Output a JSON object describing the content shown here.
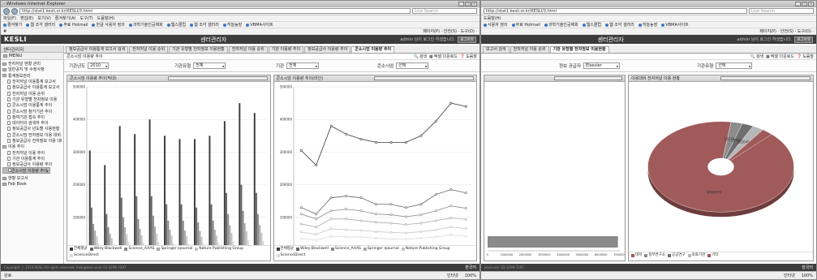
{
  "w1": {
    "title": "- Windows Internet Explorer",
    "url": "http://stat1.kesli.or.kr/KESLI/3.html",
    "search_placeholder": "Live Search",
    "menu": [
      "파일(F)",
      "편집(E)",
      "보기(V)",
      "즐겨찾기(A)",
      "도구(T)",
      "도움말(H)"
    ],
    "favorites_label": "즐겨찾기",
    "favorites": [
      "웹 조각 갤러리",
      "무료 Hotmail",
      "한글 사용자 정의",
      "과학기술인공제회",
      "웹스클럽",
      "웹 조각 갤러리",
      "히늘농장",
      "VBMA사이트"
    ],
    "tab_title": "#",
    "tab_tools": "페이지(P) · 안전(S) · 도구(O) ·",
    "app": {
      "logo": "KESLI",
      "title": "센터관리자",
      "user": "admin 님이 로그인 하셨습니다.",
      "logout": "로그아웃"
    },
    "sidebar": {
      "header": "센터관리자",
      "menu": "MENU",
      "items": [
        {
          "label": "전자저널 현황 관리",
          "level": 1
        },
        {
          "label": "일반공지 및 수정사항",
          "level": 1
        },
        {
          "label": "통계정보관리",
          "level": 1
        },
        {
          "label": "전자저널 이용통계 보고서",
          "level": 2
        },
        {
          "label": "정보공급사 이용통계 보고서",
          "level": 2
        },
        {
          "label": "전자저널 이용 순위",
          "level": 2
        },
        {
          "label": "기관 유형별 전자정보 이용",
          "level": 2
        },
        {
          "label": "콘소시엄 이용통계 추이",
          "level": 2
        },
        {
          "label": "콘소시엄 참가기관 추이",
          "level": 2
        },
        {
          "label": "참여기관 접속 추이",
          "level": 2
        },
        {
          "label": "데이터의 검색자 추이",
          "level": 2
        },
        {
          "label": "정보공급사 년도별 사용현황",
          "level": 2
        },
        {
          "label": "콘소시엄 전자정보 이용 대비",
          "level": 2
        },
        {
          "label": "정보공급사 전자정보 이용 대비",
          "level": 2
        },
        {
          "label": "이용 추이",
          "level": 1
        },
        {
          "label": "전자저널 이용 추이",
          "level": 2
        },
        {
          "label": "기관 이용통계 추이",
          "level": 2
        },
        {
          "label": "정보공급사 이용량 추이",
          "level": 2
        },
        {
          "label": "콘소시엄 이용량 추이",
          "level": 2
        },
        {
          "label": "현황 보고서",
          "level": 1
        },
        {
          "label": "Feb Book",
          "level": 1
        }
      ],
      "selected": 18
    },
    "tabs": [
      "정보공급사 이용통계 보고서 검색",
      "전자저널 이용 순위",
      "기관 유형별 전자정보 이용현황",
      "전자저널 이용 순위",
      "기관 이용량 추이",
      "정보공급사 이용량 추이",
      "콘소시엄 이용량 추이"
    ],
    "active_tab": 6,
    "sub": {
      "title": "콘소시엄 이용량 추이",
      "actions": [
        "검색",
        "엑셀 다운로드",
        "도움말"
      ]
    },
    "filters": [
      {
        "label": "기관년도",
        "value": "2010"
      },
      {
        "label": "기관유형",
        "value": "전체"
      },
      {
        "label": "기관",
        "value": "전체"
      },
      {
        "label": "콘소시엄",
        "value": "선택"
      }
    ],
    "chart1": {
      "title": "콘소시엄 이용량 추이(막대)"
    },
    "chart2": {
      "title": "콘소시엄 이용량 추이(라인)"
    },
    "footer": "Copyright ⓒ 2010 KESLI All rights reserved.  help@kesli.or.kr  02-3299-7297",
    "lang": "한국어",
    "status_left": "완료",
    "status_right": "인터넷",
    "zoom": "100%"
  },
  "w2": {
    "url": "http://stat1.kesli.or.kr/KESLI/3.html",
    "search_placeholder": "Live Search",
    "menu": [
      "도움말(H)"
    ],
    "favorites": [
      "사용자 정의",
      "무료 Hotmail",
      "과학기술인공제회",
      "웹스클럽",
      "웹 조각 갤러리",
      "히늘농장",
      "VBMA사이트"
    ],
    "tab_tools": "페이지(P) · 안전(S) · 도구(O) ·",
    "app": {
      "title": "센터관리자",
      "user": "admin 님이 로그인 하셨습니다.",
      "logout": "로그아웃"
    },
    "tabs": [
      "보고서 검색",
      "전자저널 이용 순위",
      "기관 유형별 전자정보 이용현황"
    ],
    "active_tab": 2,
    "sub": {
      "title": "정보공급사",
      "actions": [
        "검색",
        "엑셀 다운로드",
        "도움말"
      ]
    },
    "filters": [
      {
        "label": "정보 공급자",
        "value": "Elsevier"
      },
      {
        "label": "기관유형",
        "value": "선택"
      }
    ],
    "chart3": {
      "title": ""
    },
    "chart4": {
      "title": "이용대비 전자저널 이용 현황"
    },
    "footer": "kesli.or.kr  02-3299-7297",
    "lang": "한국어",
    "status_right": "인터넷",
    "zoom": "100%"
  },
  "colors": {
    "bar_series": [
      "#3a3a3a",
      "#666666",
      "#8a8a8a",
      "#a8a8a8",
      "#c4c4c4",
      "#dadada"
    ],
    "pie": [
      "#a05a5a",
      "#8c8c8c",
      "#6e6e6e",
      "#b7b7b7"
    ],
    "header_bg": "#3c3c3c"
  },
  "chart_data": [
    {
      "type": "bar",
      "title": "콘소시엄 이용량 추이(막대)",
      "categories": [
        "1월",
        "2월",
        "3월",
        "4월",
        "5월",
        "6월",
        "7월",
        "8월",
        "9월",
        "10월",
        "11월",
        "12월"
      ],
      "ylim": [
        0,
        500000
      ],
      "yticks": [
        "0",
        "100000",
        "200000",
        "300000",
        "400000",
        "500000"
      ],
      "series": [
        {
          "name": "전체평균",
          "values": [
            305000,
            260000,
            380000,
            355000,
            400000,
            350000,
            340000,
            340000,
            350000,
            395000,
            450000,
            420000
          ]
        },
        {
          "name": "Wiley-Blackwell",
          "values": [
            130000,
            110000,
            160000,
            165000,
            165000,
            140000,
            140000,
            130000,
            140000,
            175000,
            200000,
            175000
          ]
        },
        {
          "name": "Science_AAAS",
          "values": [
            80000,
            70000,
            100000,
            95000,
            105000,
            90000,
            90000,
            85000,
            90000,
            110000,
            120000,
            110000
          ]
        },
        {
          "name": "Springer ejournal",
          "values": [
            60000,
            50000,
            70000,
            65000,
            72000,
            62000,
            60000,
            58000,
            62000,
            75000,
            82000,
            76000
          ]
        },
        {
          "name": "Nature Publishing Group",
          "values": [
            42000,
            36000,
            48000,
            45000,
            50000,
            44000,
            42000,
            40000,
            44000,
            52000,
            58000,
            53000
          ]
        },
        {
          "name": "ScienceDirect",
          "values": [
            20000,
            18000,
            24000,
            22000,
            25000,
            21000,
            20000,
            20000,
            22000,
            26000,
            30000,
            27000
          ]
        }
      ]
    },
    {
      "type": "line",
      "title": "콘소시엄 이용량 추이(라인)",
      "categories": [
        "1월",
        "2월",
        "3월",
        "4월",
        "5월",
        "6월",
        "7월",
        "8월",
        "9월",
        "10월",
        "11월",
        "12월"
      ],
      "ylim": [
        0,
        500000
      ],
      "yticks": [
        "0",
        "100000",
        "200000",
        "300000",
        "400000",
        "500000"
      ],
      "series": [
        {
          "name": "전체평균",
          "values": [
            305000,
            260000,
            380000,
            355000,
            340000,
            330000,
            330000,
            330000,
            350000,
            395000,
            450000,
            440000
          ]
        },
        {
          "name": "Wiley-Blackwell",
          "values": [
            130000,
            110000,
            160000,
            165000,
            160000,
            140000,
            140000,
            130000,
            140000,
            170000,
            185000,
            175000
          ]
        },
        {
          "name": "Science_AAAS",
          "values": [
            110000,
            95000,
            120000,
            125000,
            120000,
            110000,
            108000,
            102000,
            108000,
            120000,
            135000,
            128000
          ]
        },
        {
          "name": "Springer ejournal",
          "values": [
            80000,
            70000,
            95000,
            95000,
            90000,
            85000,
            82000,
            78000,
            82000,
            90000,
            98000,
            94000
          ]
        },
        {
          "name": "Nature Publishing Group",
          "values": [
            55000,
            48000,
            65000,
            62000,
            60000,
            56000,
            54000,
            52000,
            56000,
            62000,
            70000,
            66000
          ]
        },
        {
          "name": "ScienceDirect",
          "values": [
            35000,
            30000,
            42000,
            40000,
            40000,
            36000,
            34000,
            33000,
            36000,
            40000,
            46000,
            42000
          ]
        }
      ]
    },
    {
      "type": "bar",
      "title": "",
      "categories": [
        ""
      ],
      "series": [
        {
          "name": "",
          "values": [
            6900000
          ]
        }
      ],
      "xlim": [
        0,
        7000000
      ],
      "xticks": [
        "0",
        "1000000",
        "2000000",
        "3000000",
        "4000000",
        "5000000",
        "6000000",
        "7000000"
      ]
    },
    {
      "type": "pie",
      "title": "이용대비 전자저널 이용 현황",
      "labels": [
        "대학",
        "정부연구소",
        "공공연구",
        "의료기관",
        "기타"
      ],
      "values": [
        6066076,
        2427,
        1976,
        2020,
        800
      ],
      "slice_labels": [
        "6066076",
        "242707",
        "197696",
        "202049",
        ""
      ]
    }
  ]
}
